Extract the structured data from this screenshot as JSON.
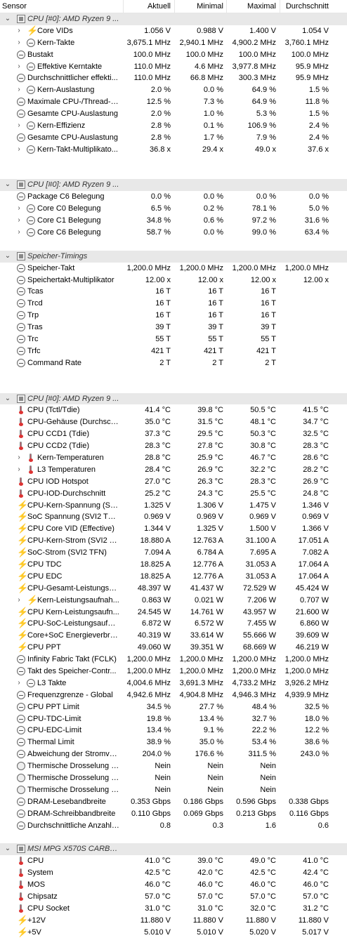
{
  "header": {
    "col_sensor": "Sensor",
    "col_current": "Aktuell",
    "col_min": "Minimal",
    "col_max": "Maximal",
    "col_avg": "Durchschnitt"
  },
  "rows": [
    {
      "kind": "group",
      "ex": "⌄",
      "icon": "chip",
      "name": "CPU [#0]: AMD Ryzen 9 ...",
      "c1": "",
      "c2": "",
      "c3": "",
      "c4": ""
    },
    {
      "kind": "row",
      "ex": "›",
      "icon": "bolt",
      "indent": 1,
      "name": "Core VIDs",
      "c1": "1.056 V",
      "c2": "0.988 V",
      "c3": "1.400 V",
      "c4": "1.054 V"
    },
    {
      "kind": "row",
      "ex": "›",
      "icon": "clock",
      "indent": 1,
      "name": "Kern-Takte",
      "c1": "3,675.1 MHz",
      "c2": "2,940.1 MHz",
      "c3": "4,900.2 MHz",
      "c4": "3,760.1 MHz"
    },
    {
      "kind": "row",
      "ex": "",
      "icon": "clock",
      "indent": 0,
      "name": "Bustakt",
      "c1": "100.0 MHz",
      "c2": "100.0 MHz",
      "c3": "100.0 MHz",
      "c4": "100.0 MHz"
    },
    {
      "kind": "row",
      "ex": "›",
      "icon": "clock",
      "indent": 1,
      "name": "Effektive Kerntakte",
      "c1": "110.0 MHz",
      "c2": "4.6 MHz",
      "c3": "3,977.8 MHz",
      "c4": "95.9 MHz"
    },
    {
      "kind": "row",
      "ex": "",
      "icon": "clock",
      "indent": 0,
      "name": "Durchschnittlicher effekti...",
      "c1": "110.0 MHz",
      "c2": "66.8 MHz",
      "c3": "300.3 MHz",
      "c4": "95.9 MHz"
    },
    {
      "kind": "row",
      "ex": "›",
      "icon": "clock",
      "indent": 1,
      "name": "Kern-Auslastung",
      "c1": "2.0 %",
      "c2": "0.0 %",
      "c3": "64.9 %",
      "c4": "1.5 %"
    },
    {
      "kind": "row",
      "ex": "",
      "icon": "clock",
      "indent": 0,
      "name": "Maximale CPU-/Thread-A...",
      "c1": "12.5 %",
      "c2": "7.3 %",
      "c3": "64.9 %",
      "c4": "11.8 %"
    },
    {
      "kind": "row",
      "ex": "",
      "icon": "clock",
      "indent": 0,
      "name": "Gesamte CPU-Auslastung",
      "c1": "2.0 %",
      "c2": "1.0 %",
      "c3": "5.3 %",
      "c4": "1.5 %"
    },
    {
      "kind": "row",
      "ex": "›",
      "icon": "clock",
      "indent": 1,
      "name": "Kern-Effizienz",
      "c1": "2.8 %",
      "c2": "0.1 %",
      "c3": "106.9 %",
      "c4": "2.4 %"
    },
    {
      "kind": "row",
      "ex": "",
      "icon": "clock",
      "indent": 0,
      "name": "Gesamte CPU-Auslastung",
      "c1": "2.8 %",
      "c2": "1.7 %",
      "c3": "7.9 %",
      "c4": "2.4 %"
    },
    {
      "kind": "row",
      "ex": "›",
      "icon": "clock",
      "indent": 1,
      "name": "Kern-Takt-Multiplikato...",
      "c1": "36.8 x",
      "c2": "29.4 x",
      "c3": "49.0 x",
      "c4": "37.6 x"
    },
    {
      "kind": "gap"
    },
    {
      "kind": "gap"
    },
    {
      "kind": "group",
      "ex": "⌄",
      "icon": "chip",
      "name": "CPU [#0]: AMD Ryzen 9 ...",
      "c1": "",
      "c2": "",
      "c3": "",
      "c4": ""
    },
    {
      "kind": "row",
      "ex": "",
      "icon": "clock",
      "indent": 0,
      "name": "Package C6 Belegung",
      "c1": "0.0 %",
      "c2": "0.0 %",
      "c3": "0.0 %",
      "c4": "0.0 %"
    },
    {
      "kind": "row",
      "ex": "›",
      "icon": "clock",
      "indent": 1,
      "name": "Core C0 Belegung",
      "c1": "6.5 %",
      "c2": "0.2 %",
      "c3": "78.1 %",
      "c4": "5.0 %"
    },
    {
      "kind": "row",
      "ex": "›",
      "icon": "clock",
      "indent": 1,
      "name": "Core C1 Belegung",
      "c1": "34.8 %",
      "c2": "0.6 %",
      "c3": "97.2 %",
      "c4": "31.6 %"
    },
    {
      "kind": "row",
      "ex": "›",
      "icon": "clock",
      "indent": 1,
      "name": "Core C6 Belegung",
      "c1": "58.7 %",
      "c2": "0.0 %",
      "c3": "99.0 %",
      "c4": "63.4 %"
    },
    {
      "kind": "gap"
    },
    {
      "kind": "group",
      "ex": "⌄",
      "icon": "chip",
      "name": "Speicher-Timings",
      "c1": "",
      "c2": "",
      "c3": "",
      "c4": ""
    },
    {
      "kind": "row",
      "ex": "",
      "icon": "clock",
      "indent": 0,
      "name": "Speicher-Takt",
      "c1": "1,200.0 MHz",
      "c2": "1,200.0 MHz",
      "c3": "1,200.0 MHz",
      "c4": "1,200.0 MHz"
    },
    {
      "kind": "row",
      "ex": "",
      "icon": "clock",
      "indent": 0,
      "name": "Speichertakt-Multiplikator",
      "c1": "12.00 x",
      "c2": "12.00 x",
      "c3": "12.00 x",
      "c4": "12.00 x"
    },
    {
      "kind": "row",
      "ex": "",
      "icon": "clock",
      "indent": 0,
      "name": "Tcas",
      "c1": "16 T",
      "c2": "16 T",
      "c3": "16 T",
      "c4": ""
    },
    {
      "kind": "row",
      "ex": "",
      "icon": "clock",
      "indent": 0,
      "name": "Trcd",
      "c1": "16 T",
      "c2": "16 T",
      "c3": "16 T",
      "c4": ""
    },
    {
      "kind": "row",
      "ex": "",
      "icon": "clock",
      "indent": 0,
      "name": "Trp",
      "c1": "16 T",
      "c2": "16 T",
      "c3": "16 T",
      "c4": ""
    },
    {
      "kind": "row",
      "ex": "",
      "icon": "clock",
      "indent": 0,
      "name": "Tras",
      "c1": "39 T",
      "c2": "39 T",
      "c3": "39 T",
      "c4": ""
    },
    {
      "kind": "row",
      "ex": "",
      "icon": "clock",
      "indent": 0,
      "name": "Trc",
      "c1": "55 T",
      "c2": "55 T",
      "c3": "55 T",
      "c4": ""
    },
    {
      "kind": "row",
      "ex": "",
      "icon": "clock",
      "indent": 0,
      "name": "Trfc",
      "c1": "421 T",
      "c2": "421 T",
      "c3": "421 T",
      "c4": ""
    },
    {
      "kind": "row",
      "ex": "",
      "icon": "clock",
      "indent": 0,
      "name": "Command Rate",
      "c1": "2 T",
      "c2": "2 T",
      "c3": "2 T",
      "c4": ""
    },
    {
      "kind": "gap"
    },
    {
      "kind": "gap"
    },
    {
      "kind": "group",
      "ex": "⌄",
      "icon": "chip",
      "name": "CPU [#0]: AMD Ryzen 9 ...",
      "c1": "",
      "c2": "",
      "c3": "",
      "c4": ""
    },
    {
      "kind": "row",
      "ex": "",
      "icon": "therm",
      "indent": 0,
      "name": "CPU (Tctl/Tdie)",
      "c1": "41.4 °C",
      "c2": "39.8 °C",
      "c3": "50.5 °C",
      "c4": "41.5 °C"
    },
    {
      "kind": "row",
      "ex": "",
      "icon": "therm",
      "indent": 0,
      "name": "CPU-Gehäuse (Durchsch...",
      "c1": "35.0 °C",
      "c2": "31.5 °C",
      "c3": "48.1 °C",
      "c4": "34.7 °C"
    },
    {
      "kind": "row",
      "ex": "",
      "icon": "therm",
      "indent": 0,
      "name": "CPU CCD1 (Tdie)",
      "c1": "37.3 °C",
      "c2": "29.5 °C",
      "c3": "50.3 °C",
      "c4": "32.5 °C"
    },
    {
      "kind": "row",
      "ex": "",
      "icon": "therm",
      "indent": 0,
      "name": "CPU CCD2 (Tdie)",
      "c1": "28.3 °C",
      "c2": "27.8 °C",
      "c3": "30.8 °C",
      "c4": "28.3 °C"
    },
    {
      "kind": "row",
      "ex": "›",
      "icon": "therm",
      "indent": 1,
      "name": "Kern-Temperaturen",
      "c1": "28.8 °C",
      "c2": "25.9 °C",
      "c3": "46.7 °C",
      "c4": "28.6 °C"
    },
    {
      "kind": "row",
      "ex": "›",
      "icon": "therm",
      "indent": 1,
      "name": "L3 Temperaturen",
      "c1": "28.4 °C",
      "c2": "26.9 °C",
      "c3": "32.2 °C",
      "c4": "28.2 °C"
    },
    {
      "kind": "row",
      "ex": "",
      "icon": "therm",
      "indent": 0,
      "name": "CPU IOD Hotspot",
      "c1": "27.0 °C",
      "c2": "26.3 °C",
      "c3": "28.3 °C",
      "c4": "26.9 °C"
    },
    {
      "kind": "row",
      "ex": "",
      "icon": "therm",
      "indent": 0,
      "name": "CPU-IOD-Durchschnitt",
      "c1": "25.2 °C",
      "c2": "24.3 °C",
      "c3": "25.5 °C",
      "c4": "24.8 °C"
    },
    {
      "kind": "row",
      "ex": "",
      "icon": "bolt",
      "indent": 0,
      "name": "CPU-Kern-Spannung (SVI...",
      "c1": "1.325 V",
      "c2": "1.306 V",
      "c3": "1.475 V",
      "c4": "1.346 V"
    },
    {
      "kind": "row",
      "ex": "",
      "icon": "bolt",
      "indent": 0,
      "name": "SoC Spannung (SVI2 TFN)",
      "c1": "0.969 V",
      "c2": "0.969 V",
      "c3": "0.969 V",
      "c4": "0.969 V"
    },
    {
      "kind": "row",
      "ex": "",
      "icon": "bolt",
      "indent": 0,
      "name": "CPU Core VID (Effective)",
      "c1": "1.344 V",
      "c2": "1.325 V",
      "c3": "1.500 V",
      "c4": "1.366 V"
    },
    {
      "kind": "row",
      "ex": "",
      "icon": "bolt",
      "indent": 0,
      "name": "CPU-Kern-Strom (SVI2 TFN)",
      "c1": "18.880 A",
      "c2": "12.763 A",
      "c3": "31.100 A",
      "c4": "17.051 A"
    },
    {
      "kind": "row",
      "ex": "",
      "icon": "bolt",
      "indent": 0,
      "name": "SoC-Strom (SVI2 TFN)",
      "c1": "7.094 A",
      "c2": "6.784 A",
      "c3": "7.695 A",
      "c4": "7.082 A"
    },
    {
      "kind": "row",
      "ex": "",
      "icon": "bolt",
      "indent": 0,
      "name": "CPU TDC",
      "c1": "18.825 A",
      "c2": "12.776 A",
      "c3": "31.053 A",
      "c4": "17.064 A"
    },
    {
      "kind": "row",
      "ex": "",
      "icon": "bolt",
      "indent": 0,
      "name": "CPU EDC",
      "c1": "18.825 A",
      "c2": "12.776 A",
      "c3": "31.053 A",
      "c4": "17.064 A"
    },
    {
      "kind": "row",
      "ex": "",
      "icon": "bolt",
      "indent": 0,
      "name": "CPU-Gesamt-Leistungsau...",
      "c1": "48.397 W",
      "c2": "41.437 W",
      "c3": "72.529 W",
      "c4": "45.424 W"
    },
    {
      "kind": "row",
      "ex": "›",
      "icon": "bolt",
      "indent": 1,
      "name": "Kern-Leistungsaufnah...",
      "c1": "0.863 W",
      "c2": "0.021 W",
      "c3": "7.206 W",
      "c4": "0.707 W"
    },
    {
      "kind": "row",
      "ex": "",
      "icon": "bolt",
      "indent": 0,
      "name": "CPU Kern-Leistungsaufn...",
      "c1": "24.545 W",
      "c2": "14.761 W",
      "c3": "43.957 W",
      "c4": "21.600 W"
    },
    {
      "kind": "row",
      "ex": "",
      "icon": "bolt",
      "indent": 0,
      "name": "CPU-SoC-Leistungsaufna...",
      "c1": "6.872 W",
      "c2": "6.572 W",
      "c3": "7.455 W",
      "c4": "6.860 W"
    },
    {
      "kind": "row",
      "ex": "",
      "icon": "bolt",
      "indent": 0,
      "name": "Core+SoC Energieverbra...",
      "c1": "40.319 W",
      "c2": "33.614 W",
      "c3": "55.666 W",
      "c4": "39.609 W"
    },
    {
      "kind": "row",
      "ex": "",
      "icon": "bolt",
      "indent": 0,
      "name": "CPU PPT",
      "c1": "49.060 W",
      "c2": "39.351 W",
      "c3": "68.669 W",
      "c4": "46.219 W"
    },
    {
      "kind": "row",
      "ex": "",
      "icon": "clock",
      "indent": 0,
      "name": "Infinity Fabric Takt (FCLK)",
      "c1": "1,200.0 MHz",
      "c2": "1,200.0 MHz",
      "c3": "1,200.0 MHz",
      "c4": "1,200.0 MHz"
    },
    {
      "kind": "row",
      "ex": "",
      "icon": "clock",
      "indent": 0,
      "name": "Takt des Speicher-Contr...",
      "c1": "1,200.0 MHz",
      "c2": "1,200.0 MHz",
      "c3": "1,200.0 MHz",
      "c4": "1,200.0 MHz"
    },
    {
      "kind": "row",
      "ex": "›",
      "icon": "clock",
      "indent": 1,
      "name": "L3 Takte",
      "c1": "4,004.6 MHz",
      "c2": "3,691.3 MHz",
      "c3": "4,733.2 MHz",
      "c4": "3,926.2 MHz"
    },
    {
      "kind": "row",
      "ex": "",
      "icon": "clock",
      "indent": 0,
      "name": "Frequenzgrenze - Global",
      "c1": "4,942.6 MHz",
      "c2": "4,904.8 MHz",
      "c3": "4,946.3 MHz",
      "c4": "4,939.9 MHz"
    },
    {
      "kind": "row",
      "ex": "",
      "icon": "clock",
      "indent": 0,
      "name": "CPU PPT Limit",
      "c1": "34.5 %",
      "c2": "27.7 %",
      "c3": "48.4 %",
      "c4": "32.5 %"
    },
    {
      "kind": "row",
      "ex": "",
      "icon": "clock",
      "indent": 0,
      "name": "CPU-TDC-Limit",
      "c1": "19.8 %",
      "c2": "13.4 %",
      "c3": "32.7 %",
      "c4": "18.0 %"
    },
    {
      "kind": "row",
      "ex": "",
      "icon": "clock",
      "indent": 0,
      "name": "CPU-EDC-Limit",
      "c1": "13.4 %",
      "c2": "9.1 %",
      "c3": "22.2 %",
      "c4": "12.2 %"
    },
    {
      "kind": "row",
      "ex": "",
      "icon": "clock",
      "indent": 0,
      "name": "Thermal Limit",
      "c1": "38.9 %",
      "c2": "35.0 %",
      "c3": "53.4 %",
      "c4": "38.6 %"
    },
    {
      "kind": "row",
      "ex": "",
      "icon": "clock",
      "indent": 0,
      "name": "Abweichung der Stromve...",
      "c1": "204.0 %",
      "c2": "176.6 %",
      "c3": "311.5 %",
      "c4": "243.0 %"
    },
    {
      "kind": "row",
      "ex": "",
      "icon": "circle",
      "indent": 0,
      "name": "Thermische Drosselung (...",
      "c1": "Nein",
      "c2": "Nein",
      "c3": "Nein",
      "c4": ""
    },
    {
      "kind": "row",
      "ex": "",
      "icon": "circle",
      "indent": 0,
      "name": "Thermische Drosselung (...",
      "c1": "Nein",
      "c2": "Nein",
      "c3": "Nein",
      "c4": ""
    },
    {
      "kind": "row",
      "ex": "",
      "icon": "circle",
      "indent": 0,
      "name": "Thermische Drosselung (...",
      "c1": "Nein",
      "c2": "Nein",
      "c3": "Nein",
      "c4": ""
    },
    {
      "kind": "row",
      "ex": "",
      "icon": "clock",
      "indent": 0,
      "name": "DRAM-Lesebandbreite",
      "c1": "0.353 Gbps",
      "c2": "0.186 Gbps",
      "c3": "0.596 Gbps",
      "c4": "0.338 Gbps"
    },
    {
      "kind": "row",
      "ex": "",
      "icon": "clock",
      "indent": 0,
      "name": "DRAM-Schreibbandbreite",
      "c1": "0.110 Gbps",
      "c2": "0.069 Gbps",
      "c3": "0.213 Gbps",
      "c4": "0.116 Gbps"
    },
    {
      "kind": "row",
      "ex": "",
      "icon": "clock",
      "indent": 0,
      "name": "Durchschnittliche Anzahl ...",
      "c1": "0.8",
      "c2": "0.3",
      "c3": "1.6",
      "c4": "0.6"
    },
    {
      "kind": "gap"
    },
    {
      "kind": "group",
      "ex": "⌄",
      "icon": "chip",
      "name": "MSI MPG X570S CARBON...",
      "c1": "",
      "c2": "",
      "c3": "",
      "c4": ""
    },
    {
      "kind": "row",
      "ex": "",
      "icon": "therm",
      "indent": 0,
      "name": "CPU",
      "c1": "41.0 °C",
      "c2": "39.0 °C",
      "c3": "49.0 °C",
      "c4": "41.0 °C"
    },
    {
      "kind": "row",
      "ex": "",
      "icon": "therm",
      "indent": 0,
      "name": "System",
      "c1": "42.5 °C",
      "c2": "42.0 °C",
      "c3": "42.5 °C",
      "c4": "42.4 °C"
    },
    {
      "kind": "row",
      "ex": "",
      "icon": "therm",
      "indent": 0,
      "name": "MOS",
      "c1": "46.0 °C",
      "c2": "46.0 °C",
      "c3": "46.0 °C",
      "c4": "46.0 °C"
    },
    {
      "kind": "row",
      "ex": "",
      "icon": "therm",
      "indent": 0,
      "name": "Chipsatz",
      "c1": "57.0 °C",
      "c2": "57.0 °C",
      "c3": "57.0 °C",
      "c4": "57.0 °C"
    },
    {
      "kind": "row",
      "ex": "",
      "icon": "therm",
      "indent": 0,
      "name": "CPU Socket",
      "c1": "31.0 °C",
      "c2": "31.0 °C",
      "c3": "32.0 °C",
      "c4": "31.2 °C"
    },
    {
      "kind": "row",
      "ex": "",
      "icon": "bolt",
      "indent": 0,
      "name": "+12V",
      "c1": "11.880 V",
      "c2": "11.880 V",
      "c3": "11.880 V",
      "c4": "11.880 V"
    },
    {
      "kind": "row",
      "ex": "",
      "icon": "bolt",
      "indent": 0,
      "name": "+5V",
      "c1": "5.010 V",
      "c2": "5.010 V",
      "c3": "5.020 V",
      "c4": "5.017 V"
    }
  ]
}
